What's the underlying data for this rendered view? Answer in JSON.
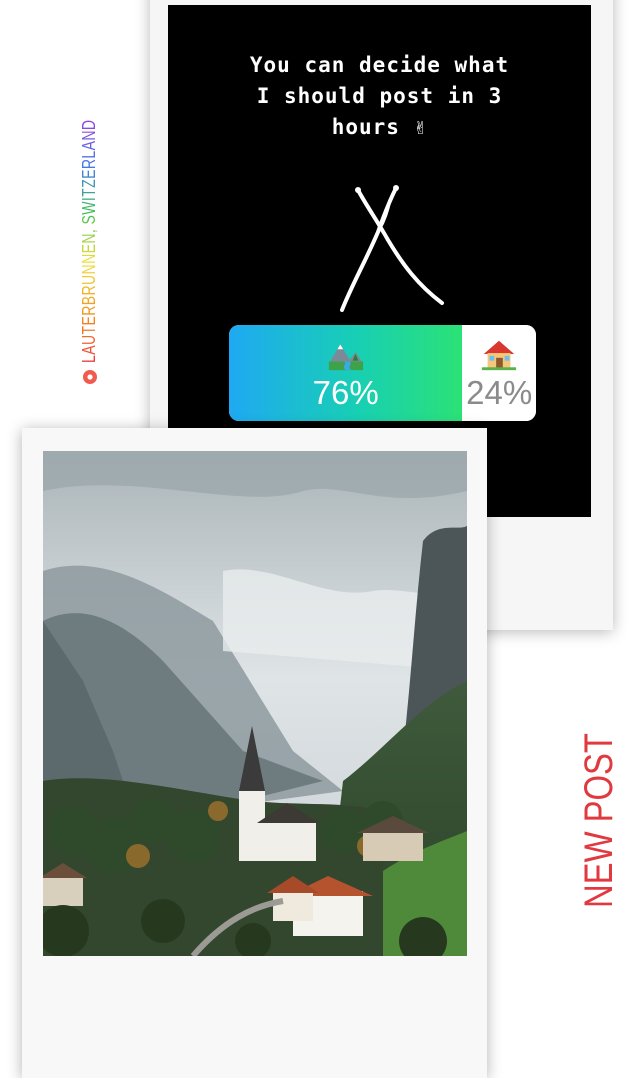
{
  "story": {
    "caption": "You can decide what\nI should post in 3\nhours ✌"
  },
  "poll": {
    "option_left": {
      "icon": "mountain-river-icon",
      "percent_label": "76%",
      "percent": 76
    },
    "option_right": {
      "icon": "house-icon",
      "percent_label": "24%",
      "percent": 24
    },
    "colors": {
      "gradient_start": "#1fa9f2",
      "gradient_end": "#2be276",
      "right_text": "#8b8b8b"
    }
  },
  "location": {
    "icon": "location-pin-icon",
    "label": "LAUTERBRUNNEN, SWITZERLAND"
  },
  "new_post_label": "NEW POST",
  "colors": {
    "new_post": "#e0393f",
    "background": "#ffffff",
    "story_bg": "#000000"
  },
  "photo": {
    "subject": "village-valley-photo"
  }
}
